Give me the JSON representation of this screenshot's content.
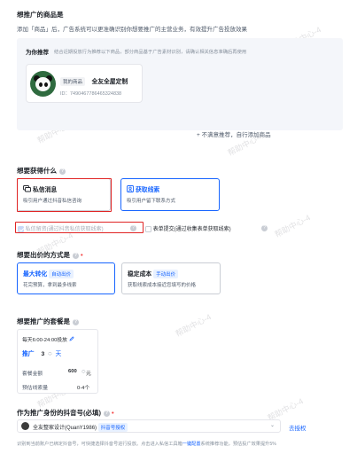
{
  "product_section": {
    "title": "想推广的商品是",
    "desc": "添加「商品」后，广告系统可以更准确识别你想要推广的主营业务，有效提升广告投放效果",
    "rec_label": "为你推荐",
    "rec_desc": "结合近期投放行为推荐以下商品，部分商品基于广告素材识别，请确认相关信息准确后再使用",
    "product_tag": "我的商品",
    "product_name": "全友全屋定制",
    "product_id": "ID：7490467786465324838",
    "add_link": "+ 不满意推荐，自行添加商品"
  },
  "goal_section": {
    "title": "想要获得什么",
    "options": [
      {
        "title": "私信消息",
        "desc": "吸引用户通过抖音私信咨询",
        "selected": false
      },
      {
        "title": "获取线索",
        "desc": "吸引用户留下联系方式",
        "selected": true
      }
    ],
    "private_retention": "私信留资(通过抖音私信获取线索)",
    "form_submit": "表单提交(通过收集表单获取线索)"
  },
  "bid_section": {
    "title": "想要出价的方式是",
    "options": [
      {
        "title": "最大转化",
        "badge": "自动出价",
        "desc": "花完预算，拿到最多线索",
        "selected": true
      },
      {
        "title": "稳定成本",
        "badge": "手动出价",
        "desc": "获取线索成本接近您填写的价格",
        "selected": false
      }
    ]
  },
  "package_section": {
    "title": "想要推广的套餐是",
    "schedule": "每天6:00-24:00投放",
    "promote_label": "推广",
    "days_value": "3",
    "days_unit": "天",
    "amount_label": "套餐金额",
    "amount_value": "600",
    "amount_unit": "元",
    "estimate_label": "预估线索量",
    "estimate_value": "0-4个"
  },
  "account_section": {
    "title": "作为推广身份的抖音号(必填)",
    "account_name": "全友整家设计(QuanY1986)",
    "account_badge": "抖音号授权",
    "authorize_link": "去授权",
    "footnote_a": "识别到当前账户已绑定抖音号，可快捷选择抖音号进行投放。点击进入私信工具箱",
    "footnote_link": "一键配置",
    "footnote_b": "系统推荐功能，预估投广效果提升5%"
  },
  "watermark": "帮助中心-4",
  "colors": {
    "accent": "#1664ff",
    "highlight_box": "#e02424",
    "panel_bg": "#f4f6fa"
  },
  "icons": [
    "chat-icon",
    "lead-card-icon",
    "edit-icon",
    "help-icon",
    "chevron-down-icon",
    "stepper-icon",
    "checkbox-icon"
  ]
}
